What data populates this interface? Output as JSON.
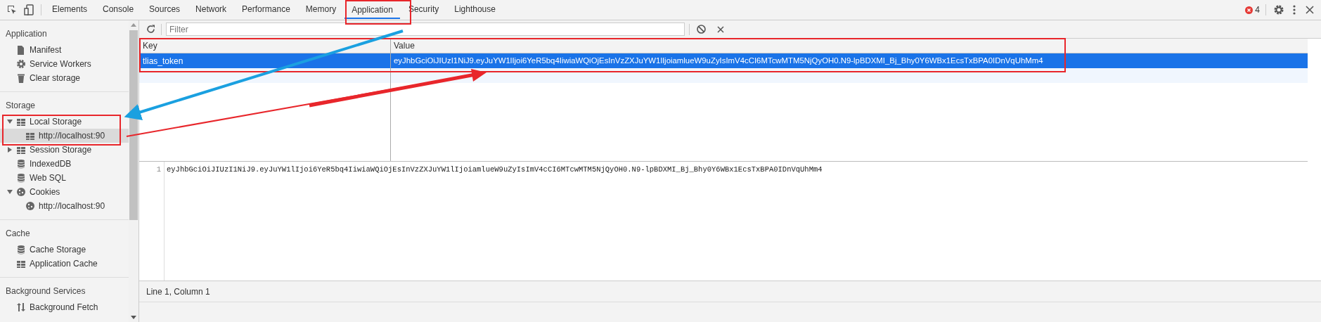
{
  "tabs": [
    {
      "label": "Elements",
      "selected": false
    },
    {
      "label": "Console",
      "selected": false
    },
    {
      "label": "Sources",
      "selected": false
    },
    {
      "label": "Network",
      "selected": false
    },
    {
      "label": "Performance",
      "selected": false
    },
    {
      "label": "Memory",
      "selected": false
    },
    {
      "label": "Application",
      "selected": true
    },
    {
      "label": "Security",
      "selected": false
    },
    {
      "label": "Lighthouse",
      "selected": false
    }
  ],
  "error_count": "4",
  "sidebar": {
    "sections": [
      {
        "title": "Application",
        "items": [
          {
            "label": "Manifest",
            "kind": "document",
            "selected": false
          },
          {
            "label": "Service Workers",
            "kind": "gear",
            "selected": false
          },
          {
            "label": "Clear storage",
            "kind": "trash",
            "selected": false
          }
        ]
      },
      {
        "title": "Storage",
        "items": [
          {
            "label": "Local Storage",
            "kind": "grid",
            "selected": false,
            "expanded": true,
            "children": [
              {
                "label": "http://localhost:90",
                "kind": "grid",
                "selected": true
              }
            ]
          },
          {
            "label": "Session Storage",
            "kind": "grid",
            "selected": false,
            "expanded": false
          },
          {
            "label": "IndexedDB",
            "kind": "database",
            "selected": false
          },
          {
            "label": "Web SQL",
            "kind": "database",
            "selected": false
          },
          {
            "label": "Cookies",
            "kind": "cookie",
            "selected": false,
            "expanded": true,
            "children": [
              {
                "label": "http://localhost:90",
                "kind": "cookie",
                "selected": false
              }
            ]
          }
        ]
      },
      {
        "title": "Cache",
        "items": [
          {
            "label": "Cache Storage",
            "kind": "database",
            "selected": false
          },
          {
            "label": "Application Cache",
            "kind": "grid",
            "selected": false
          }
        ]
      },
      {
        "title": "Background Services",
        "items": [
          {
            "label": "Background Fetch",
            "kind": "arrows",
            "selected": false
          }
        ]
      }
    ]
  },
  "filter": {
    "placeholder": "Filter"
  },
  "table": {
    "columns": [
      "Key",
      "Value"
    ],
    "rows": [
      {
        "key": "tlias_token",
        "value": "eyJhbGciOiJIUzI1NiJ9.eyJuYW1lIjoi6YeR5bq4IiwiaWQiOjEsInVzZXJuYW1lIjoiamlueW9uZyIsImV4cCI6MTcwMTM5NjQyOH0.N9-lpBDXMI_Bj_Bhy0Y6WBx1EcsTxBPA0IDnVqUhMm4",
        "selected": true
      }
    ]
  },
  "editor": {
    "lines": [
      {
        "number": "1",
        "text": "eyJhbGciOiJIUzI1NiJ9.eyJuYW1lIjoi6YeR5bq4IiwiaWQiOjEsInVzZXJuYW1lIjoiamlueW9uZyIsImV4cCI6MTcwMTM5NjQyOH0.N9-lpBDXMI_Bj_Bhy0Y6WBx1EcsTxBPA0IDnVqUhMm4"
      }
    ]
  },
  "status_bar": "Line 1, Column 1"
}
